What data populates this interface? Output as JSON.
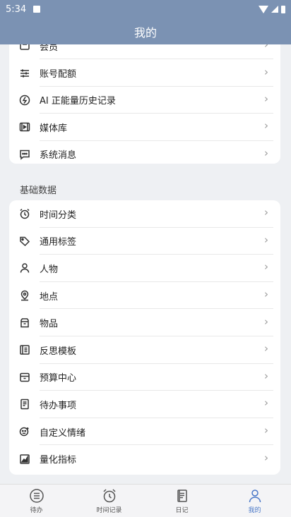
{
  "status": {
    "time": "5:34"
  },
  "appbar": {
    "title": "我的"
  },
  "card1": {
    "items": [
      {
        "label": "会员",
        "icon": "member-icon"
      },
      {
        "label": "账号配额",
        "icon": "sliders-icon"
      },
      {
        "label": "AI 正能量历史记录",
        "icon": "lightning-icon"
      },
      {
        "label": "媒体库",
        "icon": "media-icon"
      },
      {
        "label": "系统消息",
        "icon": "message-icon"
      }
    ]
  },
  "section": {
    "title": "基础数据"
  },
  "card2": {
    "items": [
      {
        "label": "时间分类",
        "icon": "alarm-clock-icon"
      },
      {
        "label": "通用标签",
        "icon": "tag-icon"
      },
      {
        "label": "人物",
        "icon": "person-icon"
      },
      {
        "label": "地点",
        "icon": "location-icon"
      },
      {
        "label": "物品",
        "icon": "box-icon"
      },
      {
        "label": "反思模板",
        "icon": "template-icon"
      },
      {
        "label": "预算中心",
        "icon": "wallet-icon"
      },
      {
        "label": "待办事项",
        "icon": "todo-icon"
      },
      {
        "label": "自定义情绪",
        "icon": "emotion-icon"
      },
      {
        "label": "量化指标",
        "icon": "chart-icon"
      }
    ]
  },
  "tabs": [
    {
      "label": "待办",
      "icon": "list-icon",
      "active": false
    },
    {
      "label": "时间记录",
      "icon": "alarm-clock-icon",
      "active": false
    },
    {
      "label": "日记",
      "icon": "diary-icon",
      "active": false
    },
    {
      "label": "我的",
      "icon": "person-icon",
      "active": true
    }
  ],
  "colors": {
    "header": "#7b92b3",
    "accent": "#4a78c8"
  }
}
